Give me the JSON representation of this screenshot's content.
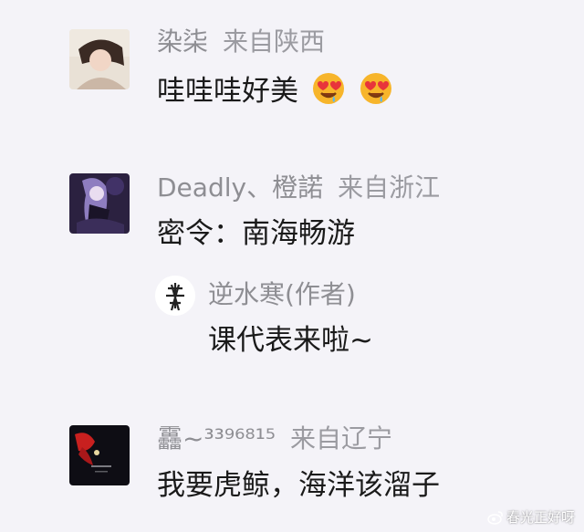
{
  "comments": [
    {
      "username": "染柒",
      "location": "来自陕西",
      "text": "哇哇哇好美",
      "emoji": [
        "heart-eyes-emoji",
        "heart-eyes-emoji"
      ]
    },
    {
      "username": "Deadly、橙諾",
      "location": "来自浙江",
      "text": "密令：南海畅游",
      "reply": {
        "username": "逆水寒(作者)",
        "text": "课代表来啦~"
      }
    },
    {
      "username": "靐~³³⁹⁶⁸¹⁵",
      "location": "来自辽宁",
      "text": "我要虎鲸，海洋该溜子"
    }
  ],
  "watermark": "春光正好呀"
}
